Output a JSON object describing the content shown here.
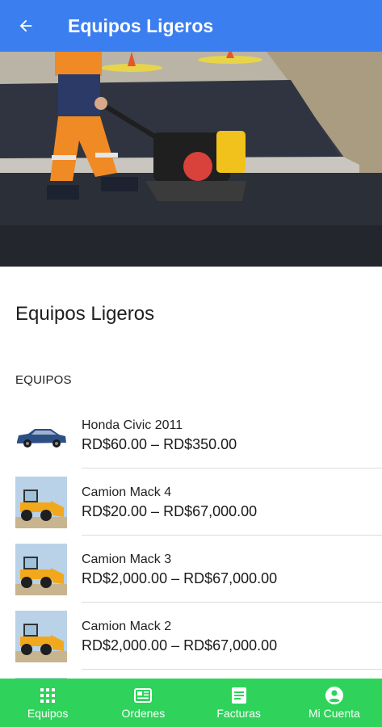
{
  "header": {
    "title": "Equipos Ligeros"
  },
  "page": {
    "title": "Equipos Ligeros",
    "section_label": "EQUIPOS"
  },
  "items": [
    {
      "name": "Honda Civic 2011",
      "price": "RD$60.00 – RD$350.00",
      "thumb": "car"
    },
    {
      "name": "Camion Mack 4",
      "price": "RD$20.00 – RD$67,000.00",
      "thumb": "loader"
    },
    {
      "name": "Camion Mack 3",
      "price": "RD$2,000.00 – RD$67,000.00",
      "thumb": "loader"
    },
    {
      "name": "Camion Mack 2",
      "price": "RD$2,000.00 – RD$67,000.00",
      "thumb": "loader"
    }
  ],
  "nav": [
    {
      "label": "Equipos",
      "icon": "grid-icon"
    },
    {
      "label": "Ordenes",
      "icon": "newspaper-icon"
    },
    {
      "label": "Facturas",
      "icon": "document-icon"
    },
    {
      "label": "Mi Cuenta",
      "icon": "account-icon"
    }
  ],
  "colors": {
    "appbar": "#3b7ef0",
    "bottom_nav": "#2fd35b"
  }
}
